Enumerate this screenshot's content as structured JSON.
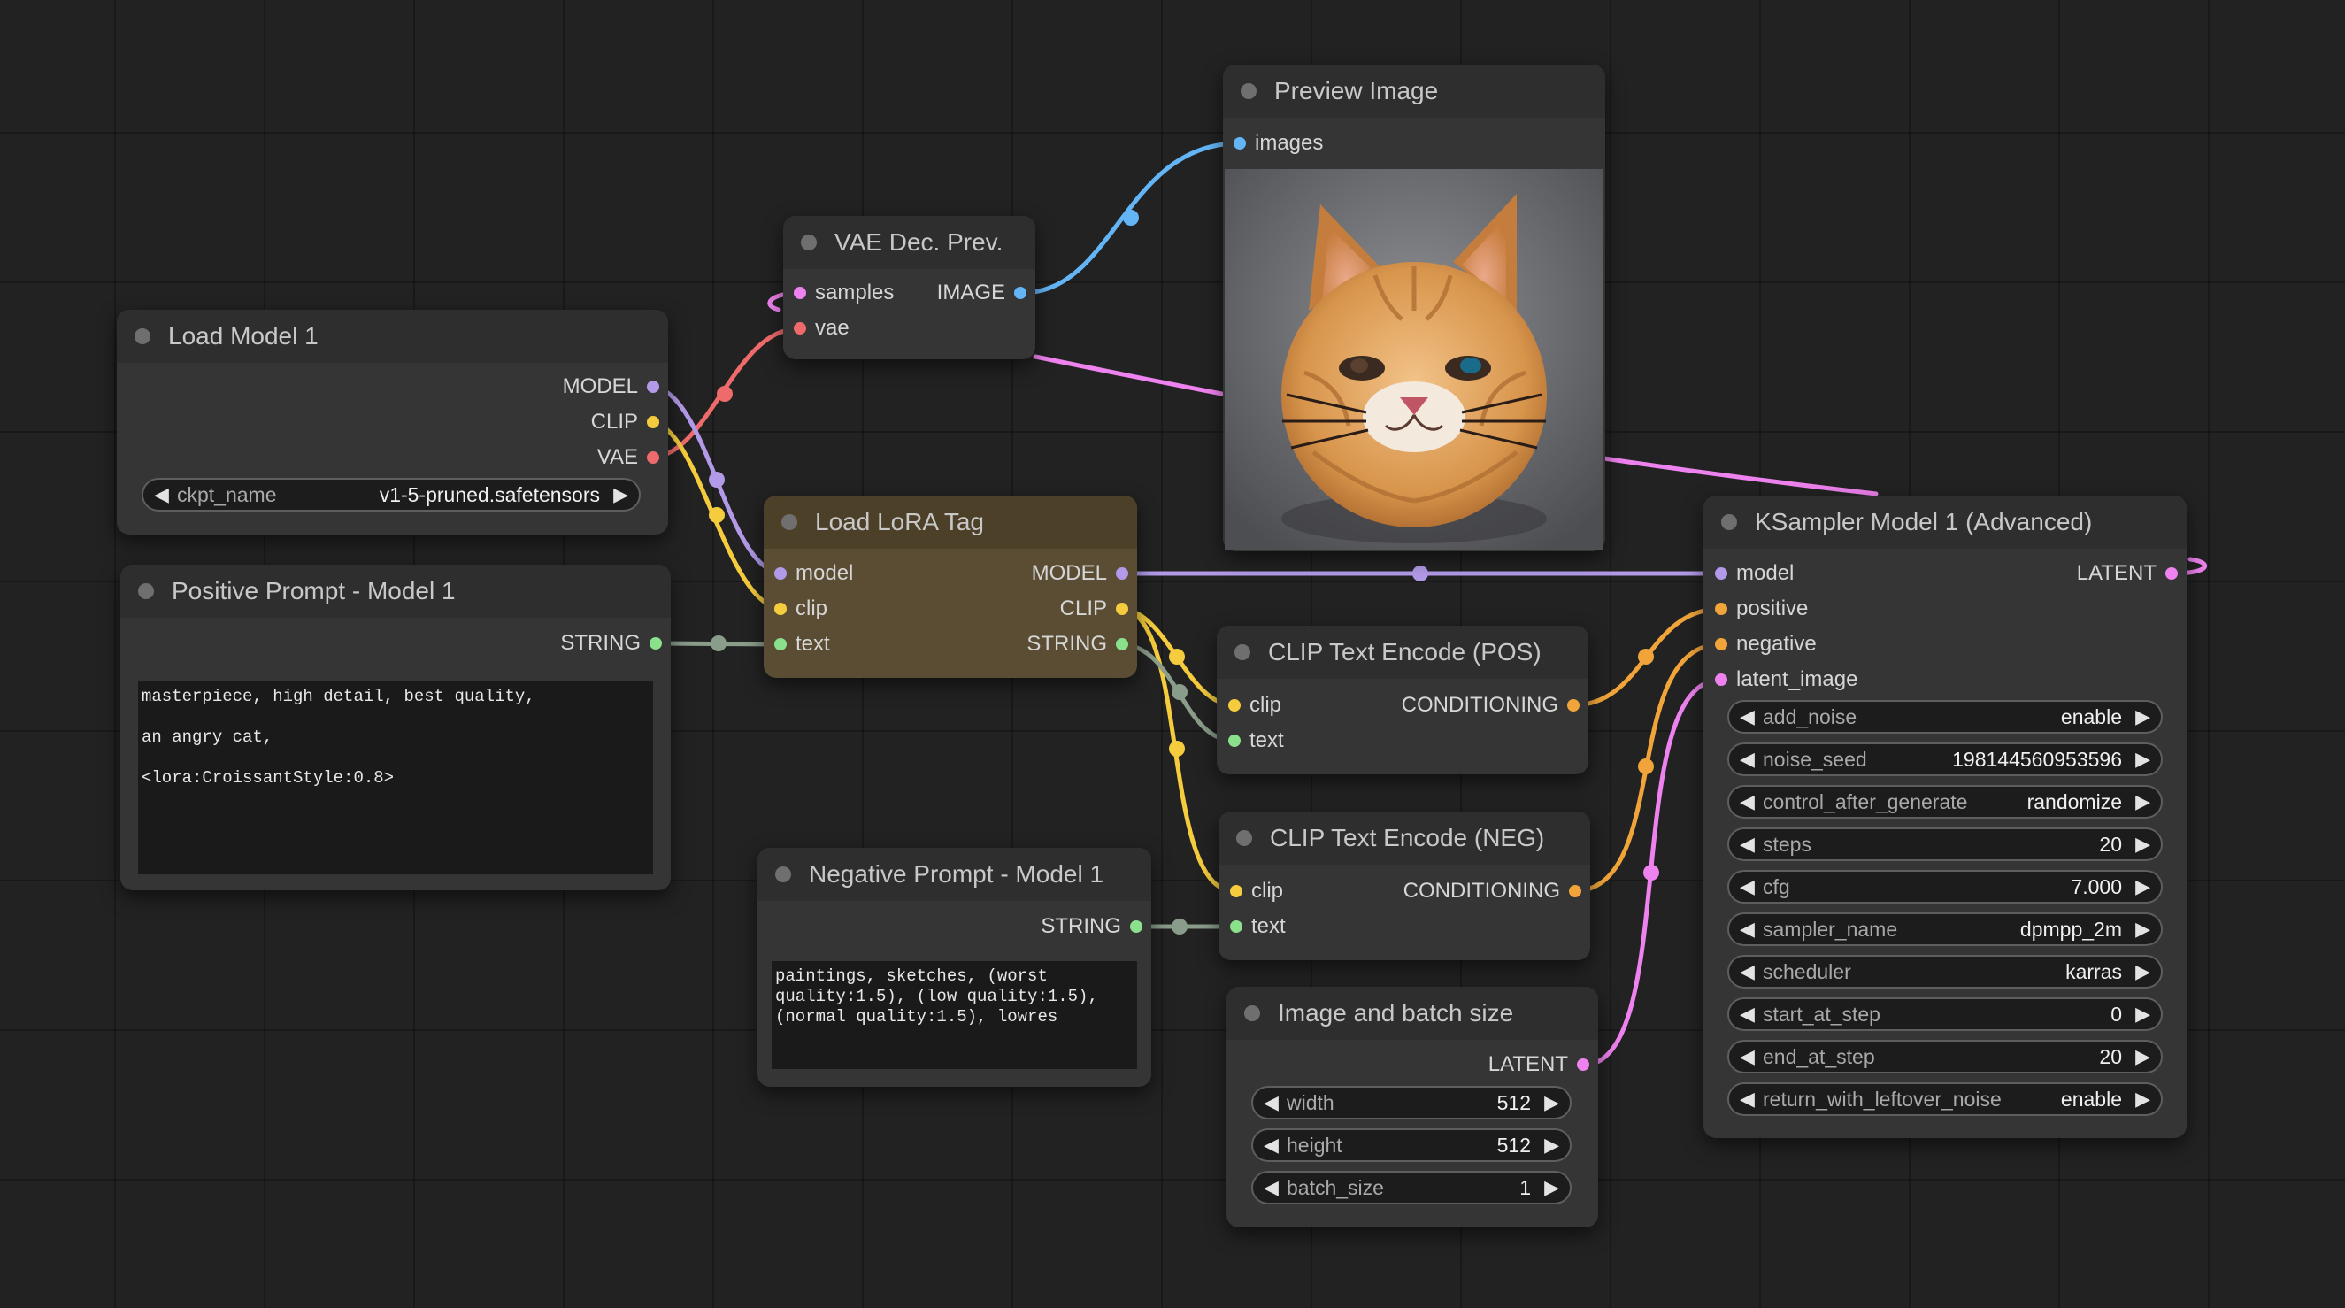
{
  "colors": {
    "model": "#b29ae8",
    "clip": "#f5cc3d",
    "vae": "#ef6b6b",
    "image": "#64b5f6",
    "latent": "#ee82ee",
    "string": "#8be08b",
    "conditioning": "#f0a43a"
  },
  "nodes": {
    "load_model": {
      "title": "Load Model 1",
      "outputs": [
        "MODEL",
        "CLIP",
        "VAE"
      ],
      "widget_name": "ckpt_name",
      "widget_value": "v1-5-pruned.safetensors"
    },
    "positive_prompt": {
      "title": "Positive Prompt - Model 1",
      "output": "STRING",
      "text": "masterpiece, high detail, best quality,\n\nan angry cat,\n\n<lora:CroissantStyle:0.8>"
    },
    "vae_dec": {
      "title": "VAE Dec. Prev.",
      "inputs": [
        "samples",
        "vae"
      ],
      "output": "IMAGE"
    },
    "preview": {
      "title": "Preview Image",
      "input": "images"
    },
    "lora": {
      "title": "Load LoRA Tag",
      "inputs": [
        "model",
        "clip",
        "text"
      ],
      "outputs": [
        "MODEL",
        "CLIP",
        "STRING"
      ]
    },
    "negative_prompt": {
      "title": "Negative Prompt - Model 1",
      "output": "STRING",
      "text": "paintings, sketches, (worst quality:1.5), (low quality:1.5), (normal quality:1.5), lowres"
    },
    "clip_pos": {
      "title": "CLIP Text Encode (POS)",
      "inputs": [
        "clip",
        "text"
      ],
      "output": "CONDITIONING"
    },
    "clip_neg": {
      "title": "CLIP Text Encode (NEG)",
      "inputs": [
        "clip",
        "text"
      ],
      "output": "CONDITIONING"
    },
    "image_batch": {
      "title": "Image and batch size",
      "output": "LATENT",
      "widgets": [
        {
          "name": "width",
          "value": "512"
        },
        {
          "name": "height",
          "value": "512"
        },
        {
          "name": "batch_size",
          "value": "1"
        }
      ]
    },
    "ksampler": {
      "title": "KSampler Model 1 (Advanced)",
      "inputs": [
        "model",
        "positive",
        "negative",
        "latent_image"
      ],
      "output": "LATENT",
      "widgets": [
        {
          "name": "add_noise",
          "value": "enable"
        },
        {
          "name": "noise_seed",
          "value": "198144560953596"
        },
        {
          "name": "control_after_generate",
          "value": "randomize"
        },
        {
          "name": "steps",
          "value": "20"
        },
        {
          "name": "cfg",
          "value": "7.000"
        },
        {
          "name": "sampler_name",
          "value": "dpmpp_2m"
        },
        {
          "name": "scheduler",
          "value": "karras"
        },
        {
          "name": "start_at_step",
          "value": "0"
        },
        {
          "name": "end_at_step",
          "value": "20"
        },
        {
          "name": "return_with_leftover_noise",
          "value": "enable"
        }
      ]
    }
  }
}
